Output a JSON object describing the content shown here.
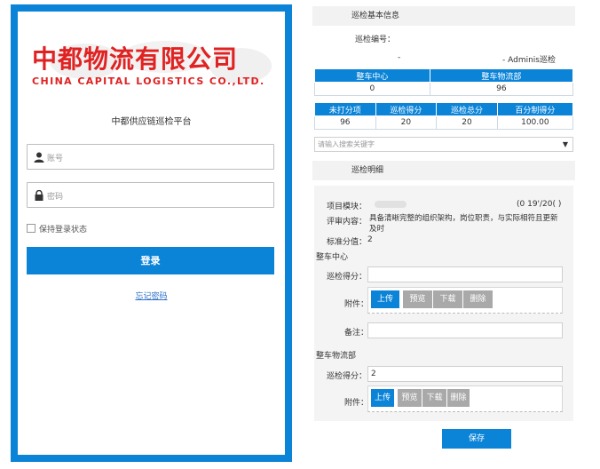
{
  "login": {
    "logo_cn": "中都物流有限公司",
    "logo_en": "CHINA CAPITAL LOGISTICS CO.,LTD.",
    "platform_title": "中都供应链巡检平台",
    "username_placeholder": "账号",
    "password_placeholder": "密码",
    "remember_label": "保持登录状态",
    "login_button": "登录",
    "forgot_password": "忘记密码",
    "accent_color": "#0b84d8",
    "logo_color": "#e02222"
  },
  "inspection": {
    "basic_info_title": "巡检基本信息",
    "inspection_no_label": "巡检编号：",
    "meta_dash": "-",
    "meta_inspector": "- Adminis巡检",
    "dept_table": {
      "headers": [
        "整车中心",
        "整车物流部"
      ],
      "values": [
        "0",
        "96"
      ]
    },
    "score_table": {
      "headers": [
        "未打分项",
        "巡检得分",
        "巡检总分",
        "百分制得分"
      ],
      "values": [
        "96",
        "20",
        "20",
        "100.00"
      ]
    },
    "search_placeholder": "请输入搜索关键字",
    "detail_title": "巡检明细",
    "item": {
      "module_label": "项目模块：",
      "counter": "(0  19'/20( )",
      "review_label": "评审内容：",
      "review_text_line1": "具备清晰完整的组织架构，岗位职责，与实际相符且更新",
      "review_text_line2": "及时",
      "standard_label": "标准分值：",
      "standard_value": "2"
    },
    "groups": [
      {
        "name": "整车中心",
        "score_label": "巡检得分：",
        "score_value": "",
        "attach_label": "附件：",
        "remark_label": "备注："
      },
      {
        "name": "整车物流部",
        "score_label": "巡检得分：",
        "score_value": "2",
        "attach_label": "附件："
      }
    ],
    "buttons": {
      "upload": "上传",
      "preview": "预览",
      "download": "下载",
      "delete": "删除"
    },
    "save_button": "保存"
  }
}
